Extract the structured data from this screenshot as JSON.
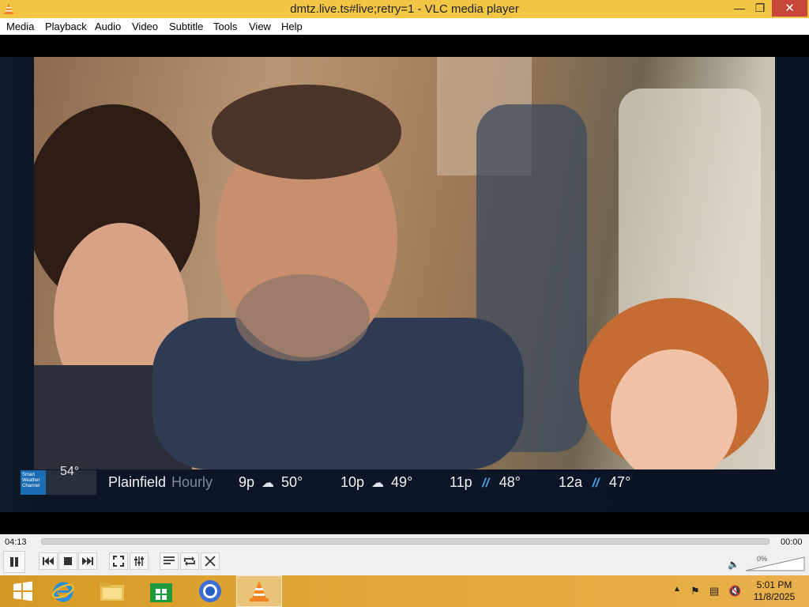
{
  "window": {
    "title": "dmtz.live.ts#live;retry=1 - VLC media player",
    "app_icon": "vlc-cone-icon",
    "minimize_icon": "minimize-icon",
    "maximize_icon": "restore-icon",
    "close_icon": "close-icon"
  },
  "menubar": {
    "items": [
      "Media",
      "Playback",
      "Audio",
      "Video",
      "Subtitle",
      "Tools",
      "View",
      "Help"
    ]
  },
  "weather": {
    "logo": "Smart Weather Channel",
    "current_temp": "54°",
    "city": "Plainfield",
    "mode": "Hourly",
    "slots": [
      {
        "time": "9p",
        "icon": "cloud-icon",
        "temp": "50°"
      },
      {
        "time": "10p",
        "icon": "cloud-icon",
        "temp": "49°"
      },
      {
        "time": "11p",
        "icon": "rain-icon",
        "temp": "48°"
      },
      {
        "time": "12a",
        "icon": "rain-icon",
        "temp": "47°"
      }
    ]
  },
  "player": {
    "elapsed": "04:13",
    "total": "00:00",
    "volume": "0%",
    "buttons": [
      "pause-icon",
      "previous-icon",
      "stop-icon",
      "next-icon",
      "fullscreen-icon",
      "extended-settings-icon",
      "playlist-icon",
      "loop-icon",
      "shuffle-icon"
    ]
  },
  "taskbar": {
    "apps": [
      "start-icon",
      "internet-explorer-icon",
      "file-explorer-icon",
      "store-icon",
      "chrome-icon",
      "vlc-icon"
    ],
    "clock_time": "5:01 PM",
    "clock_date": "11/8/2025"
  },
  "colors": {
    "titlebar": "#f2c545",
    "close_button": "#c7463a",
    "taskbar": "#e3a83a",
    "weather_logo": "#1b6db3"
  }
}
